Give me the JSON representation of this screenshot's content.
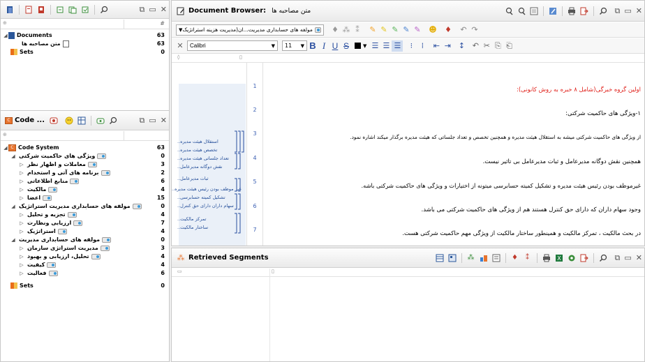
{
  "documents_panel": {
    "header_num": "#",
    "tree": [
      {
        "label": "Documents",
        "count": "63"
      },
      {
        "label": "متن مصاحبه ها",
        "count": "63"
      },
      {
        "label": "Sets",
        "count": "0"
      }
    ]
  },
  "code_system_panel": {
    "title": "Code ...",
    "tree": [
      {
        "label": "Code System",
        "count": "63"
      },
      {
        "label": "ویژگی های حاکمیت شرکتی",
        "count": "0"
      },
      {
        "label": "معاملات و اظهار نظر",
        "count": "3"
      },
      {
        "label": "برنامه های آتی و استخدام",
        "count": "2"
      },
      {
        "label": "منابع اطلاعاتی",
        "count": "6"
      },
      {
        "label": "مالکیت",
        "count": "4"
      },
      {
        "label": "اعضا",
        "count": "15"
      },
      {
        "label": "مولفه های حسابداری مدیریت استراتژیک",
        "count": "0"
      },
      {
        "label": "تجزیه و تحلیل",
        "count": "4"
      },
      {
        "label": "ارزیابی ونظارت",
        "count": "7"
      },
      {
        "label": "استراتژیک",
        "count": "4"
      },
      {
        "label": "مولفه های حسابداری مدیریت",
        "count": "0"
      },
      {
        "label": "مدیریت استراتژی سازمان",
        "count": "3"
      },
      {
        "label": "تحلیل، ارزیابی و بهبود",
        "count": "4"
      },
      {
        "label": "کیفیت",
        "count": "4"
      },
      {
        "label": "فعالیت",
        "count": "6"
      },
      {
        "label": "Sets",
        "count": "0"
      }
    ]
  },
  "document_browser": {
    "title": "Document Browser:",
    "doc_name": "متن مصاحبه ها",
    "filter_value": "مولفه های حسابداری مدیریت...ان(مدیریت هزینه استراتژیک",
    "font_name": "Calibri",
    "font_size": "11",
    "lines": [
      {
        "num": "1",
        "text": "اولین گروه خبرگی(شامل ۸ خبره به روش کانونی):",
        "color": "#e0201a"
      },
      {
        "num": "2",
        "text": "۱-ویژگی های حاکمیت شرکتی:",
        "color": "#000000"
      },
      {
        "num": "3",
        "text": "از ویژگی های حاکمیت شرکتی میشه به  استقلال هیئت مدیره  و همچنین تخصص و تعداد جلساتی که هیئت مدیره برگذار میکند اشاره نمود.",
        "color": "#000000"
      },
      {
        "num": "4",
        "text": "همچنین نقش دوگانه مدیرعامل و ثبات مدیرعامل بی تاثیر نیست.",
        "color": "#000000"
      },
      {
        "num": "5",
        "text": "غیرموظف بودن رئیس هیئت مدیره و تشکیل کمیته حسابرسی میتونه از اختیارات و ویژگی های  حاکمیت شرکتی باشه.",
        "color": "#000000"
      },
      {
        "num": "6",
        "text": "وجود سهام داران  که دارای حق کنترل هستند هم از ویژگی های حاکمیت شرکتی می باشد.",
        "color": "#000000"
      },
      {
        "num": "7",
        "text": "در بحث مالکیت ، تمرکز مالکیت و همینطور ساختار مالکیت از ویژگی مهم حاکمیت شرکتی هست.",
        "color": "#000000"
      }
    ],
    "segment_labels": [
      "استقلال هیئت مدیره..",
      "تخصص هیئت مدیره..",
      "تعداد جلساتی هیئت مدیره..",
      "نقش دوگانه مدیرعامل..",
      "ثبات مدیرعامل..",
      "غیر موظف بودن رئیس هیئت مدیره..",
      "تشکیل کمیته حسابرسی..",
      "سهام داران   دارای حق کنترل..",
      "تمرکز مالکیت..",
      "ساختار مالکیت.."
    ]
  },
  "retrieved_segments": {
    "title": "Retrieved Segments"
  },
  "colors": {
    "accent": "#2b579a",
    "orange": "#e7742f",
    "link_blue": "#3b5fb3"
  }
}
